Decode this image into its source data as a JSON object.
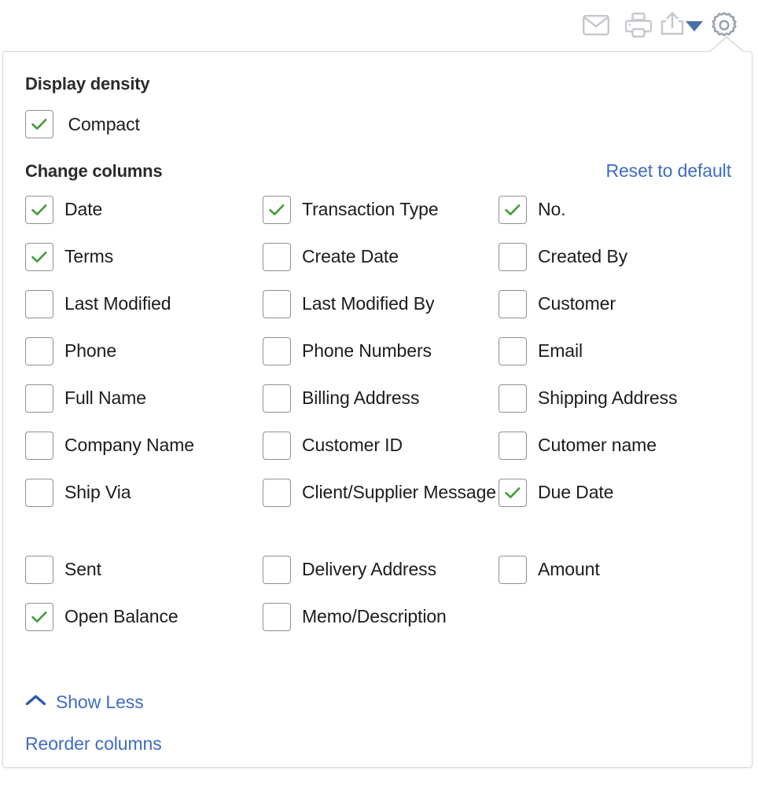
{
  "toolbar": {
    "buttons": [
      {
        "name": "email-icon",
        "label": "Email"
      },
      {
        "name": "print-icon",
        "label": "Print"
      },
      {
        "name": "export-icon",
        "label": "Export"
      },
      {
        "name": "gear-icon",
        "label": "Settings"
      }
    ],
    "caret_color": "#4a6fa5",
    "icon_color": "#c3c7cc"
  },
  "panel": {
    "display_density": {
      "title": "Display density",
      "option": {
        "label": "Compact",
        "checked": true
      }
    },
    "change_columns": {
      "title": "Change columns",
      "reset_link": "Reset to default",
      "columns": [
        [
          {
            "label": "Date",
            "checked": true
          },
          {
            "label": "Terms",
            "checked": true
          },
          {
            "label": "Last Modified",
            "checked": false
          },
          {
            "label": "Phone",
            "checked": false
          },
          {
            "label": "Full Name",
            "checked": false
          },
          {
            "label": "Company Name",
            "checked": false
          },
          {
            "label": "Ship Via",
            "checked": false
          },
          {
            "label": "Sent",
            "checked": false
          },
          {
            "label": "Open Balance",
            "checked": true
          }
        ],
        [
          {
            "label": "Transaction Type",
            "checked": true
          },
          {
            "label": "Create Date",
            "checked": false
          },
          {
            "label": "Last Modified By",
            "checked": false
          },
          {
            "label": "Phone Numbers",
            "checked": false
          },
          {
            "label": "Billing Address",
            "checked": false
          },
          {
            "label": "Customer ID",
            "checked": false
          },
          {
            "label": "Client/Supplier Message",
            "checked": false
          },
          {
            "label": "Delivery Address",
            "checked": false
          },
          {
            "label": "Memo/Description",
            "checked": false
          }
        ],
        [
          {
            "label": "No.",
            "checked": true
          },
          {
            "label": "Created By",
            "checked": false
          },
          {
            "label": "Customer",
            "checked": false
          },
          {
            "label": "Email",
            "checked": false
          },
          {
            "label": "Shipping Address",
            "checked": false
          },
          {
            "label": "Cutomer name",
            "checked": false
          },
          {
            "label": "Due Date",
            "checked": true
          },
          {
            "label": "Amount",
            "checked": false
          },
          {
            "label": "",
            "checked": false
          }
        ]
      ]
    },
    "footer": {
      "show_less": "Show Less",
      "reorder_columns": "Reorder columns"
    },
    "colors": {
      "check_green": "#3f9c35",
      "link_blue": "#3f6cc4",
      "border_gray": "#8d9096",
      "panel_border": "#d4d7dc"
    }
  }
}
